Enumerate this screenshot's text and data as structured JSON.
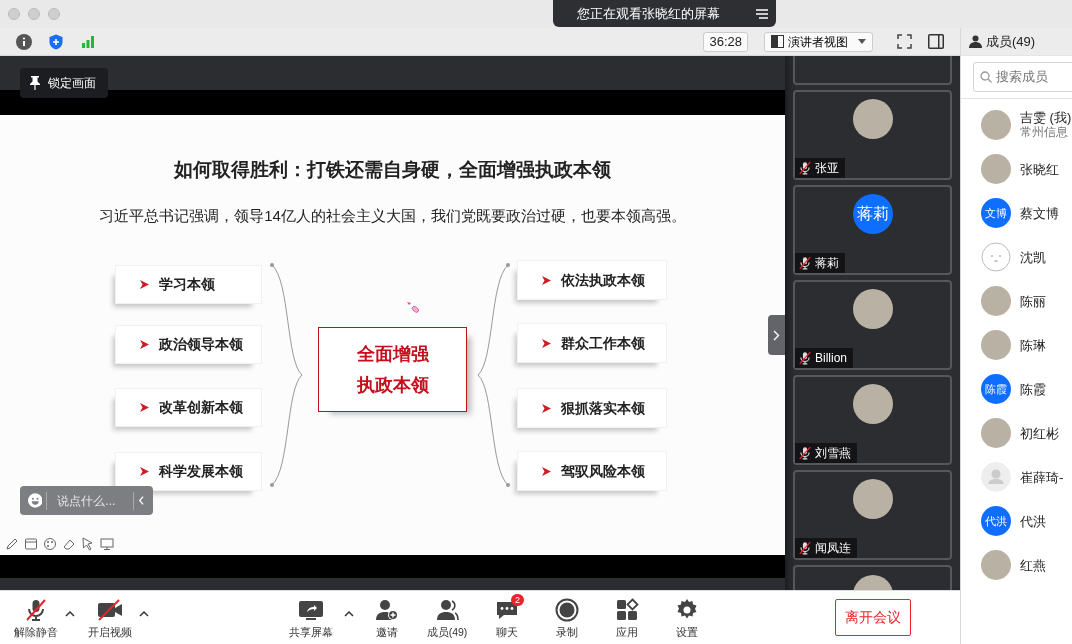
{
  "title_bar": {
    "banner": "您正在观看张晓红的屏幕"
  },
  "toolbar": {
    "timer": "36:28",
    "view_menu": "演讲者视图"
  },
  "stage": {
    "lock_button": "锁定画面",
    "chat_input": {
      "placeholder": "说点什么..."
    }
  },
  "slide": {
    "title": "如何取得胜利：打铁还需自身硬，全面增强执政本领",
    "subtitle": "习近平总书记强调，领导14亿人的社会主义大国，我们党既要政治过硬，也要本领高强。",
    "center": [
      "全面增强",
      "执政本领"
    ],
    "left_items": [
      "学习本领",
      "政治领导本领",
      "改革创新本领",
      "科学发展本领"
    ],
    "right_items": [
      "依法执政本领",
      "群众工作本领",
      "狠抓落实本领",
      "驾驭风险本领"
    ]
  },
  "video_tiles": [
    {
      "name": "张亚",
      "muted": true,
      "avatar": {
        "kind": "photo"
      }
    },
    {
      "name": "蒋莉",
      "muted": true,
      "avatar": {
        "kind": "initials",
        "text": "蒋莉"
      }
    },
    {
      "name": "Billion",
      "muted": true,
      "avatar": {
        "kind": "photo"
      }
    },
    {
      "name": "刘雪燕",
      "muted": true,
      "avatar": {
        "kind": "photo"
      }
    },
    {
      "name": "闻凤连",
      "muted": true,
      "avatar": {
        "kind": "photo"
      }
    }
  ],
  "bottom_bar": {
    "items": [
      {
        "kind": "mute",
        "label": "解除静音",
        "has_menu": true
      },
      {
        "kind": "video",
        "label": "开启视频",
        "has_menu": true
      },
      {
        "kind": "share",
        "label": "共享屏幕",
        "has_menu": true
      },
      {
        "kind": "invite",
        "label": "邀请",
        "has_menu": false
      },
      {
        "kind": "members",
        "label": "成员(49)",
        "has_menu": false
      },
      {
        "kind": "chat",
        "label": "聊天",
        "has_menu": false,
        "badge": "2"
      },
      {
        "kind": "record",
        "label": "录制",
        "has_menu": false
      },
      {
        "kind": "apps",
        "label": "应用",
        "has_menu": false
      },
      {
        "kind": "settings",
        "label": "设置",
        "has_menu": false
      }
    ],
    "leave_button": "离开会议"
  },
  "members_panel": {
    "title": "成员(49)",
    "search": {
      "placeholder": "搜索成员"
    },
    "members": [
      {
        "name": "吉雯 (我)",
        "detail": "常州信息",
        "avatar": {
          "kind": "photo"
        }
      },
      {
        "name": "张晓红",
        "avatar": {
          "kind": "photo"
        }
      },
      {
        "name": "蔡文博",
        "avatar": {
          "kind": "initials",
          "text": "文博"
        }
      },
      {
        "name": "沈凯",
        "avatar": {
          "kind": "face"
        }
      },
      {
        "name": "陈丽",
        "avatar": {
          "kind": "photo"
        }
      },
      {
        "name": "陈琳",
        "avatar": {
          "kind": "photo"
        }
      },
      {
        "name": "陈霞",
        "avatar": {
          "kind": "initials",
          "text": "陈霞"
        }
      },
      {
        "name": "初红彬",
        "avatar": {
          "kind": "photo"
        }
      },
      {
        "name": "崔薛琦-",
        "avatar": {
          "kind": "default"
        }
      },
      {
        "name": "代洪",
        "avatar": {
          "kind": "initials",
          "text": "代洪"
        }
      },
      {
        "name": "红燕",
        "avatar": {
          "kind": "photo"
        }
      }
    ]
  }
}
